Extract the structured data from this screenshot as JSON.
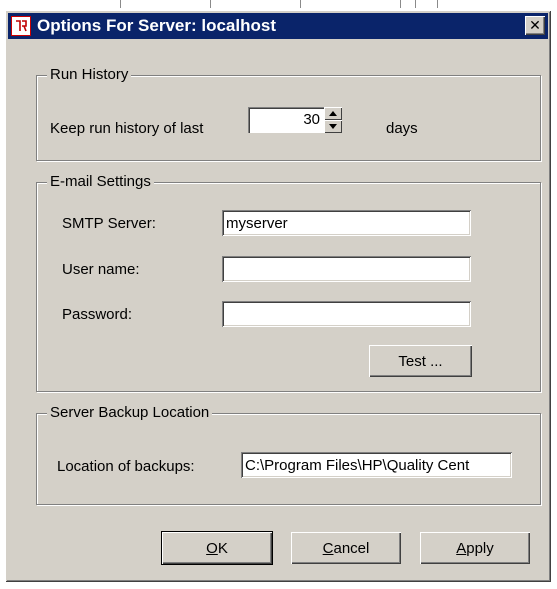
{
  "window": {
    "title": "Options For Server: localhost",
    "app_icon": "app-icon",
    "close_glyph": "✕"
  },
  "run_history": {
    "group_label": "Run History",
    "keep_label": "Keep run history of last",
    "days_value": "30",
    "days_unit": "days"
  },
  "email": {
    "group_label": "E-mail Settings",
    "smtp_label": "SMTP Server:",
    "smtp_value": "myserver",
    "user_label": "User name:",
    "user_value": "",
    "password_label": "Password:",
    "password_value": "",
    "test_button": "Test ..."
  },
  "backup": {
    "group_label": "Server Backup Location",
    "location_label": "Location of backups:",
    "location_value": "C:\\Program Files\\HP\\Quality Cent"
  },
  "buttons": {
    "ok_mnemonic": "O",
    "ok_rest": "K",
    "cancel_mnemonic": "C",
    "cancel_rest": "ancel",
    "apply_mnemonic": "A",
    "apply_rest": "pply"
  },
  "colors": {
    "titlebar": "#0a246a",
    "dialog_face": "#d4d0c8"
  }
}
